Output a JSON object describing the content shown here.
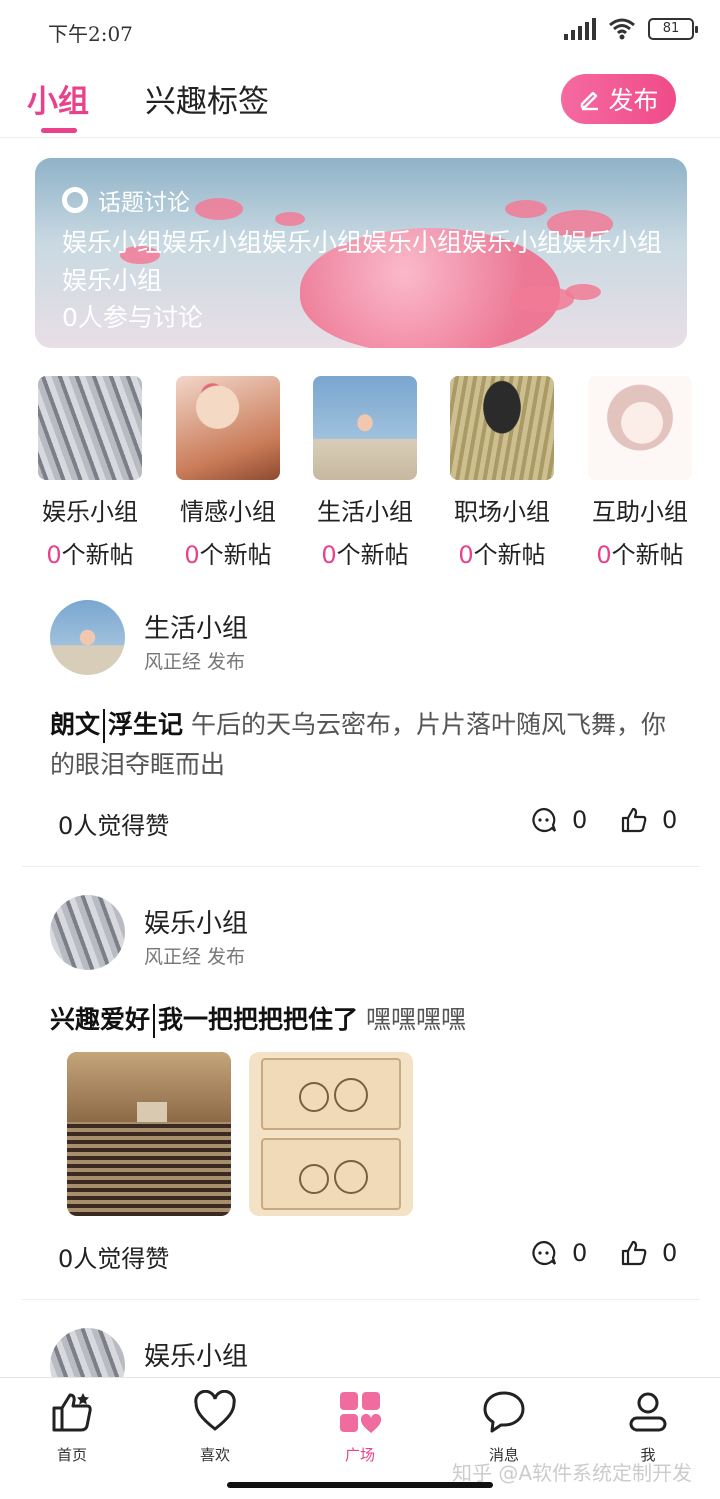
{
  "status_bar": {
    "time": "下午2:07",
    "battery": "81"
  },
  "top_nav": {
    "tabs": [
      {
        "label": "小组"
      },
      {
        "label": "兴趣标签"
      }
    ],
    "publish_label": "发布"
  },
  "banner": {
    "tag": "话题讨论",
    "title": "娱乐小组娱乐小组娱乐小组娱乐小组娱乐小组娱乐小组娱乐小组",
    "participants": "0人参与讨论"
  },
  "groups": [
    {
      "name": "娱乐小组",
      "count": "0",
      "suffix": "个新帖"
    },
    {
      "name": "情感小组",
      "count": "0",
      "suffix": "个新帖"
    },
    {
      "name": "生活小组",
      "count": "0",
      "suffix": "个新帖"
    },
    {
      "name": "职场小组",
      "count": "0",
      "suffix": "个新帖"
    },
    {
      "name": "互助小组",
      "count": "0",
      "suffix": "个新帖"
    }
  ],
  "posts": [
    {
      "group": "生活小组",
      "author": "风正经 发布",
      "tag1": "朗文",
      "tag2": "浮生记",
      "text": "午后的天乌云密布，片片落叶随风飞舞，你的眼泪夺眶而出",
      "likes_text": "0人觉得赞",
      "comments": "0",
      "thumbs": "0"
    },
    {
      "group": "娱乐小组",
      "author": "风正经 发布",
      "tag1": "兴趣爱好",
      "tag2": "我一把把把把住了",
      "text": "嘿嘿嘿嘿",
      "likes_text": "0人觉得赞",
      "comments": "0",
      "thumbs": "0"
    },
    {
      "group": "娱乐小组"
    }
  ],
  "bottom_nav": [
    {
      "label": "首页",
      "icon": "thumbs-up-icon"
    },
    {
      "label": "喜欢",
      "icon": "heart-icon"
    },
    {
      "label": "广场",
      "icon": "square-grid-icon"
    },
    {
      "label": "消息",
      "icon": "chat-bubble-icon"
    },
    {
      "label": "我",
      "icon": "person-icon"
    }
  ],
  "watermark": "知乎 @A软件系统定制开发",
  "colors": {
    "accent": "#e9428a"
  }
}
